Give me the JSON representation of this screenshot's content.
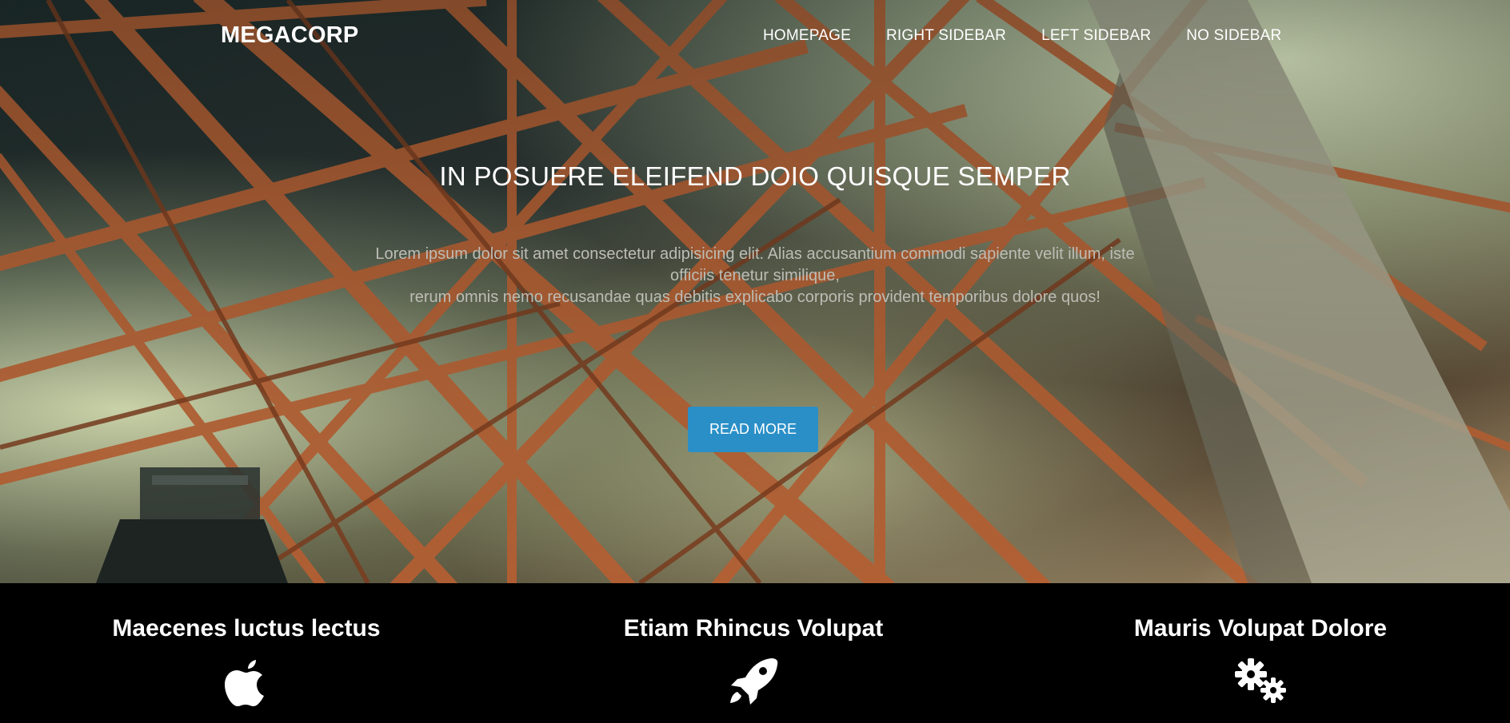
{
  "brand": "MEGACORP",
  "nav": {
    "items": [
      "HOMEPAGE",
      "RIGHT SIDEBAR",
      "LEFT SIDEBAR",
      "NO SIDEBAR"
    ]
  },
  "hero": {
    "title": "IN POSUERE ELEIFEND DOIO QUISQUE SEMPER",
    "text_line1": "Lorem ipsum dolor sit amet consectetur adipisicing elit. Alias accusantium commodi sapiente velit illum, iste officiis tenetur similique,",
    "text_line2": "rerum omnis nemo recusandae quas debitis explicabo corporis provident temporibus dolore quos!",
    "button_label": "READ MORE",
    "button_color": "#2a8fc7"
  },
  "features": [
    {
      "title": "Maecenes luctus lectus",
      "icon": "apple-icon"
    },
    {
      "title": "Etiam Rhincus Volupat",
      "icon": "rocket-icon"
    },
    {
      "title": "Mauris Volupat Dolore",
      "icon": "gears-icon"
    }
  ]
}
